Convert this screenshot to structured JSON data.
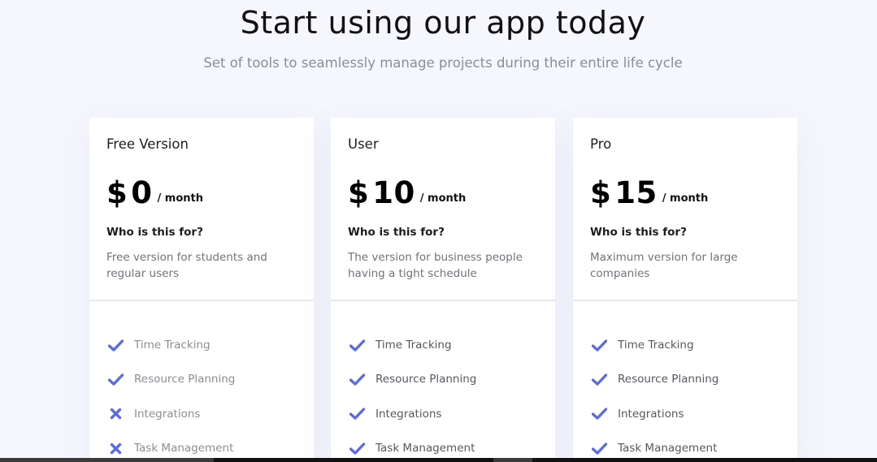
{
  "header": {
    "title": "Start using our app today",
    "subtitle": "Set of tools to seamlessly manage projects during their entire life cycle"
  },
  "colors": {
    "accent": "#5b6ce0",
    "background": "#f6f7fd",
    "card": "#ffffff"
  },
  "plans": [
    {
      "name": "Free Version",
      "currency": "$",
      "amount": "0",
      "period": "/ month",
      "who_label": "Who is this for?",
      "description": "Free version for students and regular users",
      "features": [
        {
          "label": "Time Tracking",
          "included": true,
          "icon": "check-icon"
        },
        {
          "label": "Resource Planning",
          "included": true,
          "icon": "check-icon"
        },
        {
          "label": "Integrations",
          "included": false,
          "icon": "cross-icon"
        },
        {
          "label": "Task Management",
          "included": false,
          "icon": "cross-icon"
        }
      ]
    },
    {
      "name": "User",
      "currency": "$",
      "amount": "10",
      "period": "/ month",
      "who_label": "Who is this for?",
      "description": "The version for business people having a tight schedule",
      "features": [
        {
          "label": "Time Tracking",
          "included": true,
          "icon": "check-icon"
        },
        {
          "label": "Resource Planning",
          "included": true,
          "icon": "check-icon"
        },
        {
          "label": "Integrations",
          "included": true,
          "icon": "check-icon"
        },
        {
          "label": "Task Management",
          "included": true,
          "icon": "check-icon"
        }
      ]
    },
    {
      "name": "Pro",
      "currency": "$",
      "amount": "15",
      "period": "/ month",
      "who_label": "Who is this for?",
      "description": "Maximum version for large companies",
      "features": [
        {
          "label": "Time Tracking",
          "included": true,
          "icon": "check-icon"
        },
        {
          "label": "Resource Planning",
          "included": true,
          "icon": "check-icon"
        },
        {
          "label": "Integrations",
          "included": true,
          "icon": "check-icon"
        },
        {
          "label": "Task Management",
          "included": true,
          "icon": "check-icon"
        }
      ]
    }
  ]
}
